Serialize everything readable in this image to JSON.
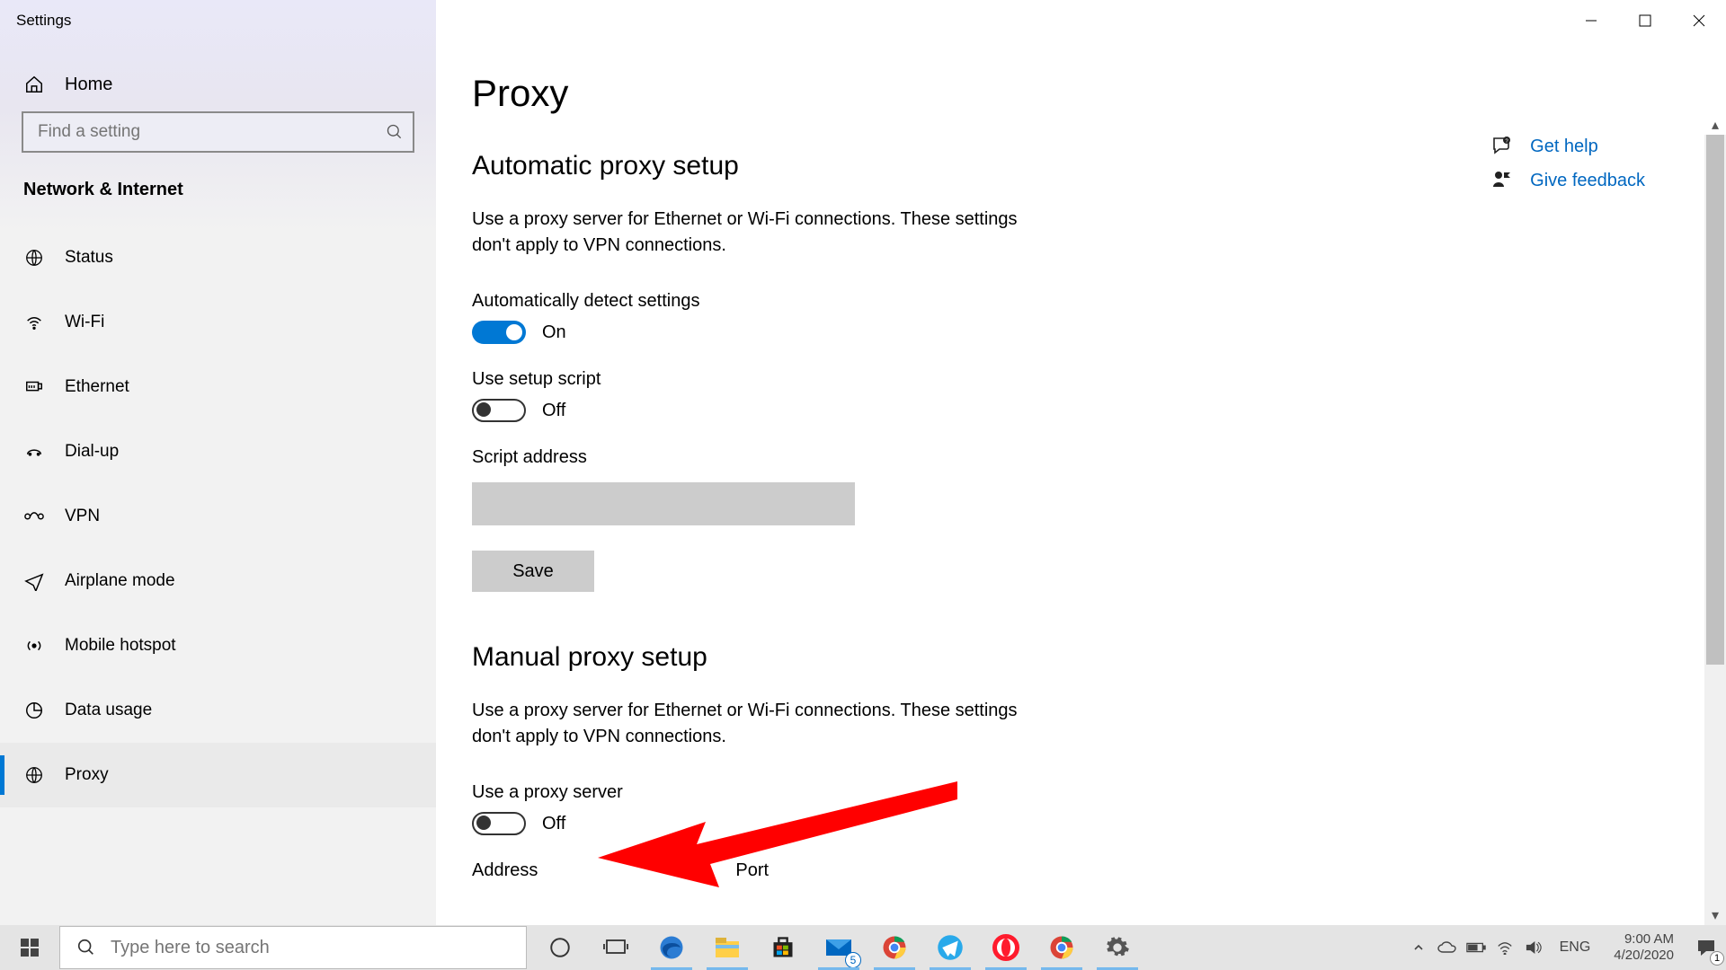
{
  "window": {
    "title": "Settings"
  },
  "sidebar": {
    "home": "Home",
    "search_placeholder": "Find a setting",
    "section": "Network & Internet",
    "items": [
      {
        "label": "Status"
      },
      {
        "label": "Wi-Fi"
      },
      {
        "label": "Ethernet"
      },
      {
        "label": "Dial-up"
      },
      {
        "label": "VPN"
      },
      {
        "label": "Airplane mode"
      },
      {
        "label": "Mobile hotspot"
      },
      {
        "label": "Data usage"
      },
      {
        "label": "Proxy"
      }
    ]
  },
  "main": {
    "title": "Proxy",
    "auto_section": "Automatic proxy setup",
    "auto_desc": "Use a proxy server for Ethernet or Wi-Fi connections. These settings don't apply to VPN connections.",
    "auto_detect_label": "Automatically detect settings",
    "auto_detect_state": "On",
    "setup_script_label": "Use setup script",
    "setup_script_state": "Off",
    "script_address_label": "Script address",
    "script_address_value": "",
    "save_btn": "Save",
    "manual_section": "Manual proxy setup",
    "manual_desc": "Use a proxy server for Ethernet or Wi-Fi connections. These settings don't apply to VPN connections.",
    "use_proxy_label": "Use a proxy server",
    "use_proxy_state": "Off",
    "address_label": "Address",
    "port_label": "Port"
  },
  "links": {
    "help": "Get help",
    "feedback": "Give feedback"
  },
  "taskbar": {
    "search_placeholder": "Type here to search",
    "mail_badge": "5",
    "lang": "ENG",
    "time": "9:00 AM",
    "date": "4/20/2020",
    "notif_count": "1"
  }
}
